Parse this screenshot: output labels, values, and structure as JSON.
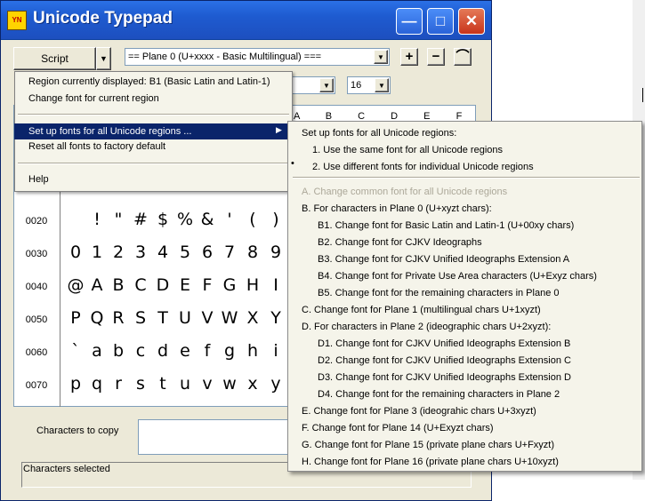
{
  "window": {
    "title": "Unicode Typepad",
    "icon_text": "YN",
    "controls": {
      "minimize": "—",
      "maximize": "□",
      "close": "✕"
    }
  },
  "toolbar": {
    "script_label": "Script",
    "plane_value": "== Plane 0 (U+xxxx - Basic Multilingual) ===",
    "plus": "+",
    "minus": "−",
    "tilde": "⌒",
    "size_value": "16"
  },
  "grid": {
    "header": "A B C D E F",
    "rows": [
      {
        "label": "0020",
        "chars": [
          "",
          "!",
          "\"",
          "#",
          "$",
          "%",
          "&",
          "'",
          "(",
          ")"
        ]
      },
      {
        "label": "0030",
        "chars": [
          "0",
          "1",
          "2",
          "3",
          "4",
          "5",
          "6",
          "7",
          "8",
          "9"
        ]
      },
      {
        "label": "0040",
        "chars": [
          "@",
          "A",
          "B",
          "C",
          "D",
          "E",
          "F",
          "G",
          "H",
          "I"
        ]
      },
      {
        "label": "0050",
        "chars": [
          "P",
          "Q",
          "R",
          "S",
          "T",
          "U",
          "V",
          "W",
          "X",
          "Y"
        ]
      },
      {
        "label": "0060",
        "chars": [
          "`",
          "a",
          "b",
          "c",
          "d",
          "e",
          "f",
          "g",
          "h",
          "i"
        ]
      },
      {
        "label": "0070",
        "chars": [
          "p",
          "q",
          "r",
          "s",
          "t",
          "u",
          "v",
          "w",
          "x",
          "y"
        ]
      }
    ]
  },
  "copy": {
    "label": "Characters to copy",
    "selected_label": "Characters selected"
  },
  "menu": {
    "items": [
      "Region currently displayed: B1 (Basic Latin and Latin-1)",
      "Change font for current region",
      "Set up fonts for all Unicode regions ...",
      "Reset all fonts to factory default",
      "Help"
    ]
  },
  "submenu": {
    "items": [
      "Set up fonts for all Unicode regions:",
      "1. Use the same font for all Unicode regions",
      "2. Use different fonts for individual Unicode regions",
      "A. Change common font for all Unicode regions",
      "B. For characters in Plane 0 (U+xyzt chars):",
      "B1. Change font for Basic Latin and Latin-1 (U+00xy chars)",
      "B2. Change font for CJKV Ideographs",
      "B3. Change font for CJKV Unified Ideographs Extension A",
      "B4. Change font for Private Use Area characters (U+Exyz chars)",
      "B5. Change font for the remaining characters in Plane 0",
      "C. Change font for Plane 1 (multilingual chars U+1xyzt)",
      "D. For characters in Plane 2 (ideographic chars U+2xyzt):",
      "D1. Change font for CJKV Unified Ideographs Extension B",
      "D2. Change font for CJKV Unified Ideographs Extension C",
      "D3. Change font for CJKV Unified Ideographs Extension D",
      "D4. Change font for the remaining characters in Plane 2",
      "E. Change font for Plane 3 (ideograhic chars U+3xyzt)",
      "F. Change font for Plane 14 (U+Exyzt chars)",
      "G. Change font for Plane 15 (private plane chars U+Fxyzt)",
      "H. Change font for Plane 16 (private plane chars U+10xyzt)"
    ],
    "bullet": "•"
  }
}
